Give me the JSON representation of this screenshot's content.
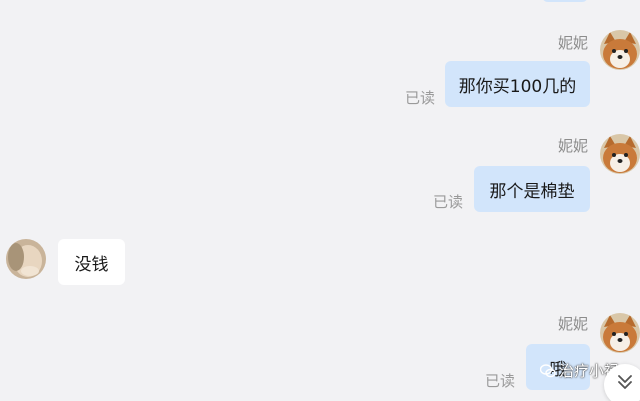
{
  "messages": [
    {
      "sender": "妮妮",
      "text": "那你买100几的",
      "status": "已读"
    },
    {
      "sender": "妮妮",
      "text": "那个是棉垫",
      "status": "已读"
    },
    {
      "text": "没钱"
    },
    {
      "sender": "妮妮",
      "text": "哦",
      "status": "已读"
    }
  ],
  "watermark": "治疗小禄",
  "icons": {
    "my_avatar": "shiba-dog-avatar",
    "other_avatar": "blurred-photo-avatar",
    "watermark": "wechat-logo-icon",
    "scroll": "double-chevron-down-icon"
  },
  "colors": {
    "background": "#f2f2f4",
    "my_bubble": "#d2e5fb",
    "their_bubble": "#ffffff"
  }
}
